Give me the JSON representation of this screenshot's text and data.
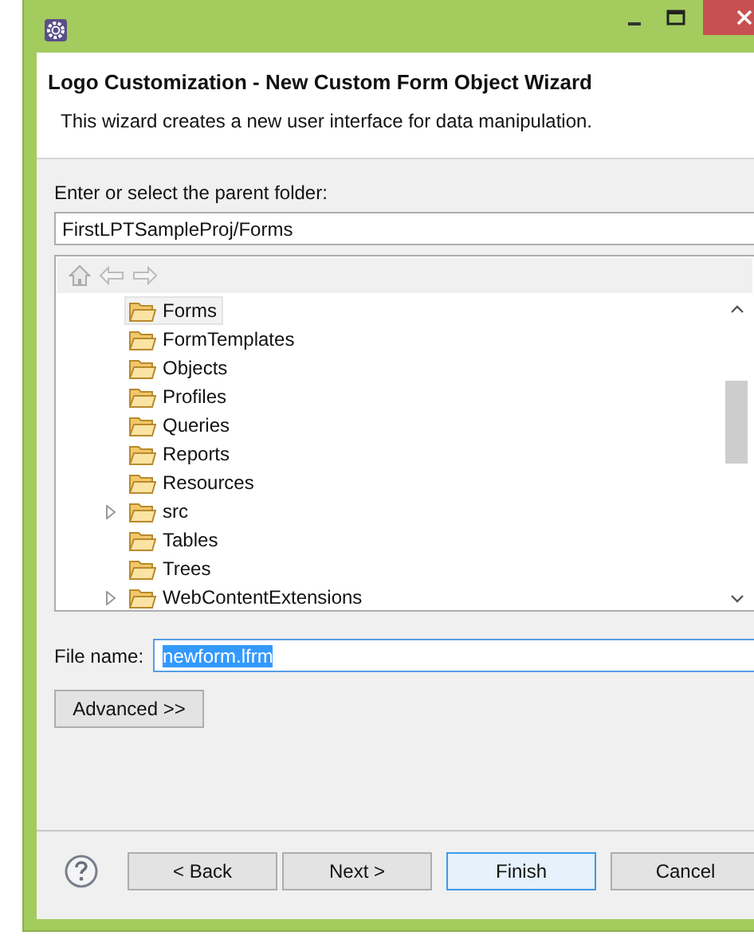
{
  "header": {
    "title": "Logo Customization - New Custom Form Object Wizard",
    "description": "This wizard creates a new user interface for data manipulation."
  },
  "parent_folder": {
    "label": "Enter or select the parent folder:",
    "value": "FirstLPTSampleProj/Forms"
  },
  "tree": {
    "items": [
      {
        "label": "Forms",
        "selected": true
      },
      {
        "label": "FormTemplates",
        "selected": false
      },
      {
        "label": "Objects",
        "selected": false
      },
      {
        "label": "Profiles",
        "selected": false
      },
      {
        "label": "Queries",
        "selected": false
      },
      {
        "label": "Reports",
        "selected": false
      },
      {
        "label": "Resources",
        "selected": false
      },
      {
        "label": "src",
        "selected": false,
        "expanded": false
      },
      {
        "label": "Tables",
        "selected": false
      },
      {
        "label": "Trees",
        "selected": false
      },
      {
        "label": "WebContentExtensions",
        "selected": false,
        "expanded": false
      }
    ]
  },
  "file_name": {
    "label": "File name:",
    "value": "newform.lfrm",
    "text_selected": true
  },
  "advanced_button": "Advanced >>",
  "footer_buttons": [
    {
      "label": "< Back",
      "default": false
    },
    {
      "label": "Next >",
      "default": false
    },
    {
      "label": "Finish",
      "default": true
    },
    {
      "label": "Cancel",
      "default": false
    }
  ]
}
